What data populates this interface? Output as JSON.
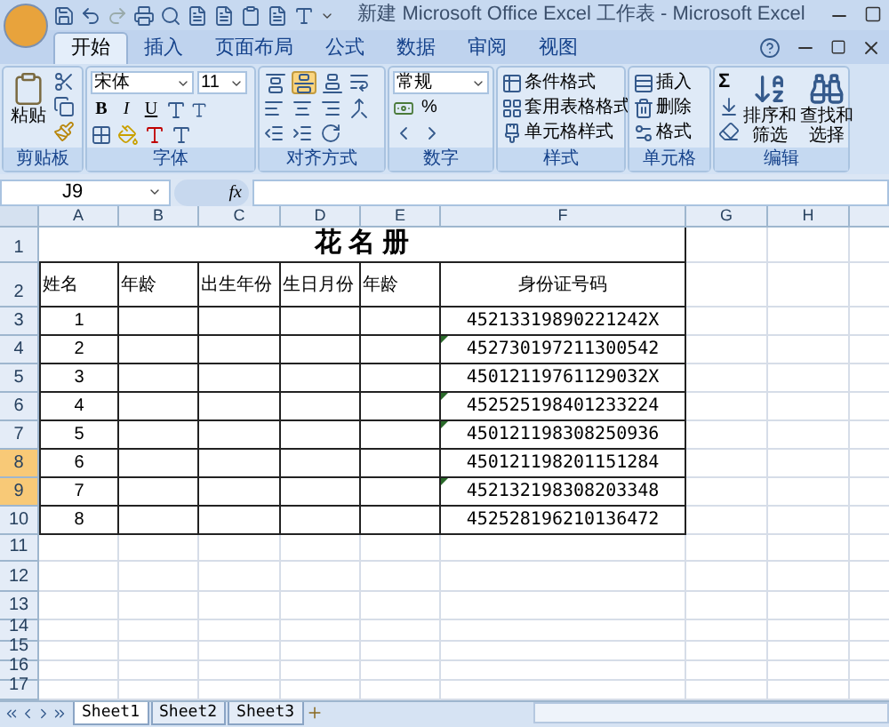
{
  "window": {
    "title": "新建 Microsoft Office Excel 工作表 - Microsoft Excel"
  },
  "tabs": [
    {
      "label": "开始",
      "selected": true
    },
    {
      "label": "插入",
      "selected": false
    },
    {
      "label": "页面布局",
      "selected": false
    },
    {
      "label": "公式",
      "selected": false
    },
    {
      "label": "数据",
      "selected": false
    },
    {
      "label": "审阅",
      "selected": false
    },
    {
      "label": "视图",
      "selected": false
    }
  ],
  "ribbon": {
    "clipboard": {
      "label": "剪贴板",
      "paste": "粘贴"
    },
    "font": {
      "label": "字体",
      "name": "宋体",
      "size": "11",
      "styles": [
        "B",
        "I",
        "U"
      ]
    },
    "alignment": {
      "label": "对齐方式",
      "vertical": [
        {
          "selected": false
        },
        {
          "selected": true
        },
        {
          "selected": false
        }
      ]
    },
    "number": {
      "label": "数字",
      "format": "常规",
      "percent": "%"
    },
    "styles": {
      "label": "样式",
      "items": [
        "条件格式",
        "套用表格格式",
        "单元格样式"
      ]
    },
    "cells": {
      "label": "单元格",
      "items": [
        "插入",
        "删除",
        "格式"
      ]
    },
    "editing": {
      "label": "编辑",
      "sum": "Σ",
      "sort": [
        "排序和",
        "筛选"
      ],
      "find": [
        "查找和",
        "选择"
      ]
    }
  },
  "formula_bar": {
    "name_box": "J9",
    "function_label": "fx"
  },
  "sheet": {
    "columns": [
      {
        "label": "A"
      },
      {
        "label": "B"
      },
      {
        "label": "C"
      },
      {
        "label": "D"
      },
      {
        "label": "E"
      },
      {
        "label": "F"
      },
      {
        "label": "G"
      },
      {
        "label": "H"
      }
    ],
    "rows": [
      {
        "label": "1",
        "selected": false
      },
      {
        "label": "2",
        "selected": false
      },
      {
        "label": "3",
        "selected": false
      },
      {
        "label": "4",
        "selected": false
      },
      {
        "label": "5",
        "selected": false
      },
      {
        "label": "6",
        "selected": false
      },
      {
        "label": "7",
        "selected": false
      },
      {
        "label": "8",
        "selected": true
      },
      {
        "label": "9",
        "selected": true
      },
      {
        "label": "10",
        "selected": false
      },
      {
        "label": "11",
        "selected": false
      },
      {
        "label": "12",
        "selected": false
      },
      {
        "label": "13",
        "selected": false
      },
      {
        "label": "14",
        "selected": false
      },
      {
        "label": "15",
        "selected": false
      },
      {
        "label": "16",
        "selected": false
      },
      {
        "label": "17",
        "selected": false
      }
    ],
    "title": "花 名 册",
    "header": [
      "姓名",
      "年龄",
      "出生年份",
      "生日月份",
      "年龄",
      "身份证号码"
    ],
    "records": [
      {
        "no": "1",
        "id": "45213319890221242X",
        "error_marker": false
      },
      {
        "no": "2",
        "id": "452730197211300542",
        "error_marker": true
      },
      {
        "no": "3",
        "id": "45012119761129032X",
        "error_marker": false
      },
      {
        "no": "4",
        "id": "452525198401233224",
        "error_marker": true
      },
      {
        "no": "5",
        "id": "450121198308250936",
        "error_marker": true
      },
      {
        "no": "6",
        "id": "450121198201151284",
        "error_marker": false
      },
      {
        "no": "7",
        "id": "452132198308203348",
        "error_marker": true
      },
      {
        "no": "8",
        "id": "452528196210136472",
        "error_marker": false
      }
    ]
  },
  "sheet_tabs": [
    {
      "label": "Sheet1",
      "selected": true
    },
    {
      "label": "Sheet2",
      "selected": false
    },
    {
      "label": "Sheet3",
      "selected": false
    }
  ]
}
